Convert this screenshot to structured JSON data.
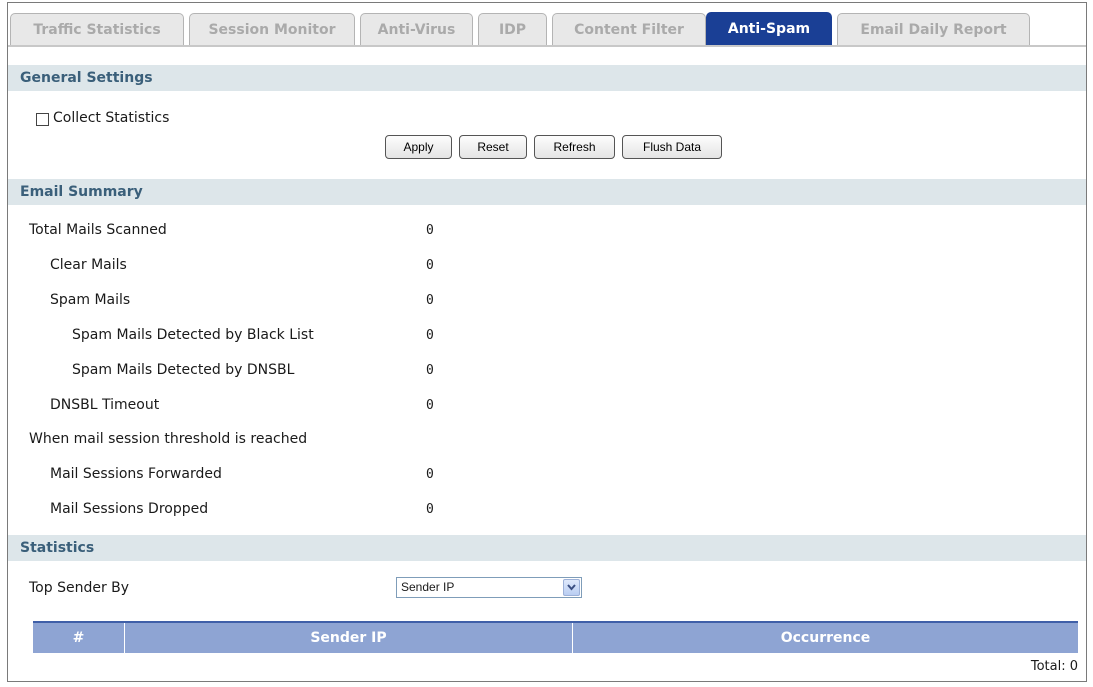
{
  "tabs": [
    {
      "label": "Traffic Statistics",
      "active": false
    },
    {
      "label": "Session Monitor",
      "active": false
    },
    {
      "label": "Anti-Virus",
      "active": false
    },
    {
      "label": "IDP",
      "active": false
    },
    {
      "label": "Content Filter",
      "active": false
    },
    {
      "label": "Anti-Spam",
      "active": true
    },
    {
      "label": "Email Daily Report",
      "active": false
    }
  ],
  "general": {
    "title": "General Settings",
    "collect_statistics_label": "Collect Statistics",
    "collect_statistics_checked": false,
    "buttons": {
      "apply": "Apply",
      "reset": "Reset",
      "refresh": "Refresh",
      "flush": "Flush Data"
    }
  },
  "summary": {
    "title": "Email Summary",
    "rows": [
      {
        "label": "Total Mails Scanned",
        "value": "0"
      },
      {
        "label": "Clear Mails",
        "value": "0"
      },
      {
        "label": "Spam Mails",
        "value": "0"
      },
      {
        "label": "Spam Mails Detected by Black List",
        "value": "0"
      },
      {
        "label": "Spam Mails Detected by DNSBL",
        "value": "0"
      },
      {
        "label": "DNSBL Timeout",
        "value": "0"
      },
      {
        "label": "When mail session threshold is reached",
        "value": ""
      },
      {
        "label": "Mail Sessions Forwarded",
        "value": "0"
      },
      {
        "label": "Mail Sessions Dropped",
        "value": "0"
      }
    ]
  },
  "statistics": {
    "title": "Statistics",
    "top_sender_label": "Top Sender By",
    "top_sender_value": "Sender IP",
    "table": {
      "headers": [
        "#",
        "Sender IP",
        "Occurrence"
      ]
    },
    "total": "Total:  0"
  },
  "colors": {
    "active_tab": "#1a3f95",
    "section_bg": "#dde6ea",
    "section_text": "#3a5f7a",
    "table_header": "#8ea4d3"
  }
}
